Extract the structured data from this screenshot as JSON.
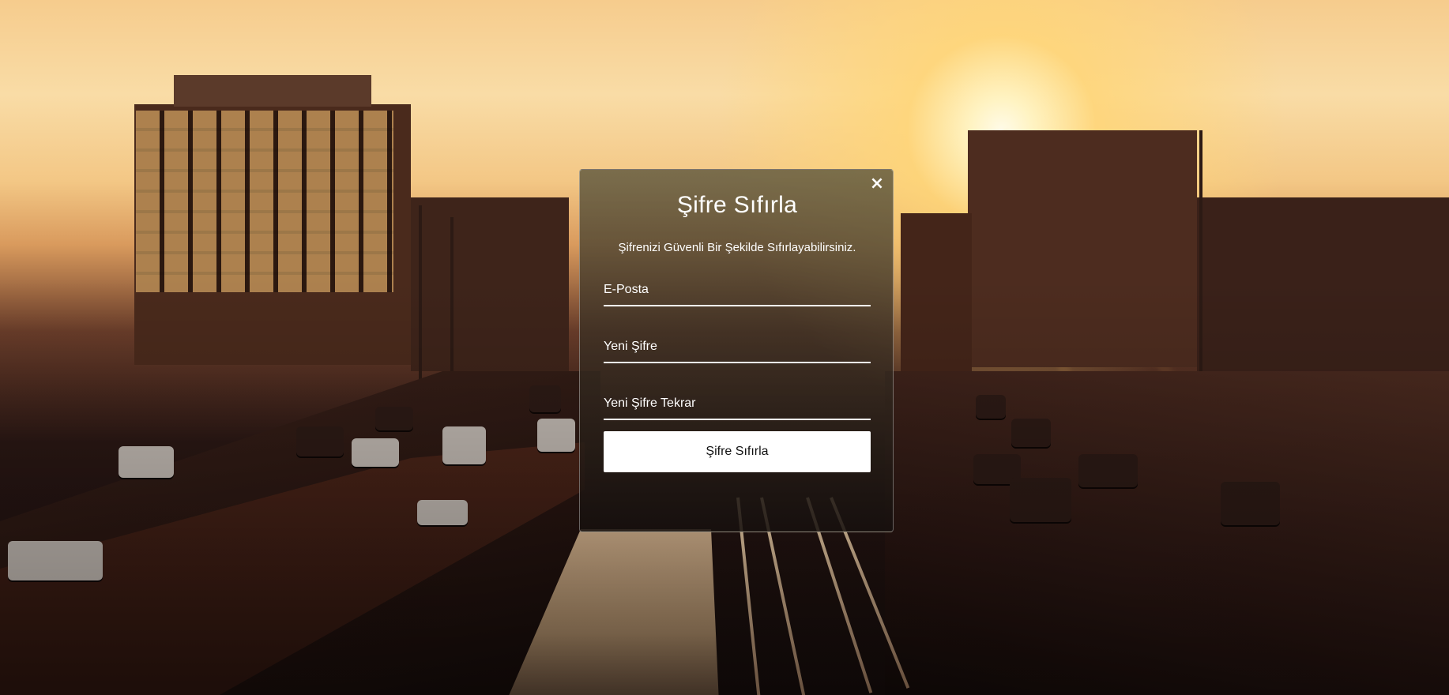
{
  "modal": {
    "close_label": "×",
    "title": "Şifre Sıfırla",
    "subtitle": "Şifrenizi Güvenli Bir Şekilde Sıfırlayabilirsiniz.",
    "email_placeholder": "E-Posta",
    "new_password_placeholder": "Yeni Şifre",
    "new_password_repeat_placeholder": "Yeni Şifre Tekrar",
    "submit_label": "Şifre Sıfırla"
  },
  "colors": {
    "modal_text": "#ffffff",
    "button_background": "#ffffff",
    "button_text": "#111111"
  },
  "icons": {
    "close": "close-icon"
  }
}
